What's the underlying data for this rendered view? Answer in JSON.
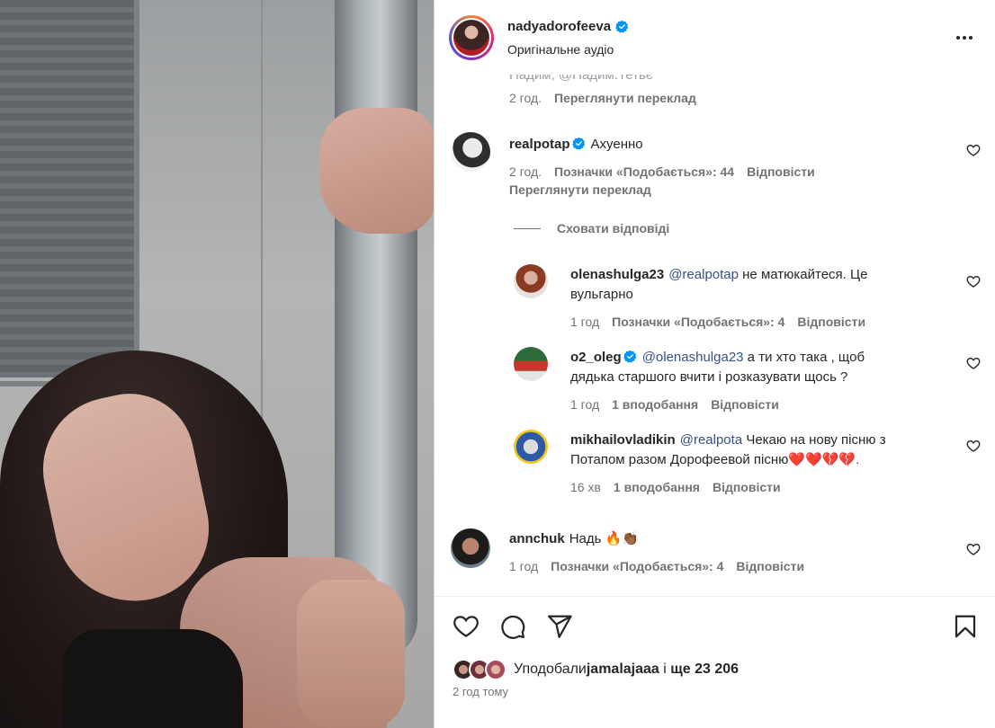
{
  "header": {
    "username": "nadyadorofeeva",
    "subtitle": "Оригінальне аудіо",
    "icons": {
      "verified": "verified-badge-icon",
      "more": "more-options-icon"
    }
  },
  "cut_off": {
    "text": "Надим, @Надим.Тетьє",
    "time": "2 год.",
    "translate": "Переглянути переклад"
  },
  "comments": [
    {
      "username": "realpotap",
      "verified": true,
      "text": "Ахуенно",
      "time": "2 год.",
      "likes": "Позначки «Подобається»: 44",
      "reply": "Відповісти",
      "translate": "Переглянути переклад"
    }
  ],
  "hide_replies": "Сховати відповіді",
  "replies": [
    {
      "username": "olenashulga23",
      "mention": "@realpotap",
      "text_line1": " не матюкайтеся. Це",
      "text_line2": "вульгарно",
      "time": "1 год",
      "likes": "Позначки «Подобається»: 4",
      "reply": "Відповісти"
    },
    {
      "username": "o2_oleg",
      "verified": true,
      "mention": "@olenashulga23",
      "text_line1": " а ти хто така , щоб",
      "text_line2": "дядька старшого вчити і розказувати щось ?",
      "time": "1 год",
      "likes": "1 вподобання",
      "reply": "Відповісти"
    },
    {
      "username": "mikhailovladikin",
      "mention": "@realpota",
      "text_line1": " Чекаю на нову пісню з",
      "text_line2": "Потапом разом Дорофеевой пісню",
      "text_emojis": "❤️❤️💔💔.",
      "time": "16 хв",
      "likes": "1 вподобання",
      "reply": "Відповісти"
    }
  ],
  "last_comment": {
    "username": "annchuk",
    "text": "Надь 🔥👏🏾",
    "time": "1 год",
    "likes": "Позначки «Подобається»: 4",
    "reply": "Відповісти"
  },
  "footer": {
    "liked_by_prefix": "Уподобали ",
    "liked_by_user": "jamalajaaa",
    "liked_by_suffix_join": " і ",
    "liked_by_others": "ще 23 206",
    "time_ago": "2 год тому",
    "icons": [
      "like-icon",
      "comment-icon",
      "share-icon",
      "save-icon"
    ]
  },
  "colors": {
    "link": "#385185",
    "muted": "#737373",
    "text": "#262626",
    "verified": "#0095f6"
  }
}
